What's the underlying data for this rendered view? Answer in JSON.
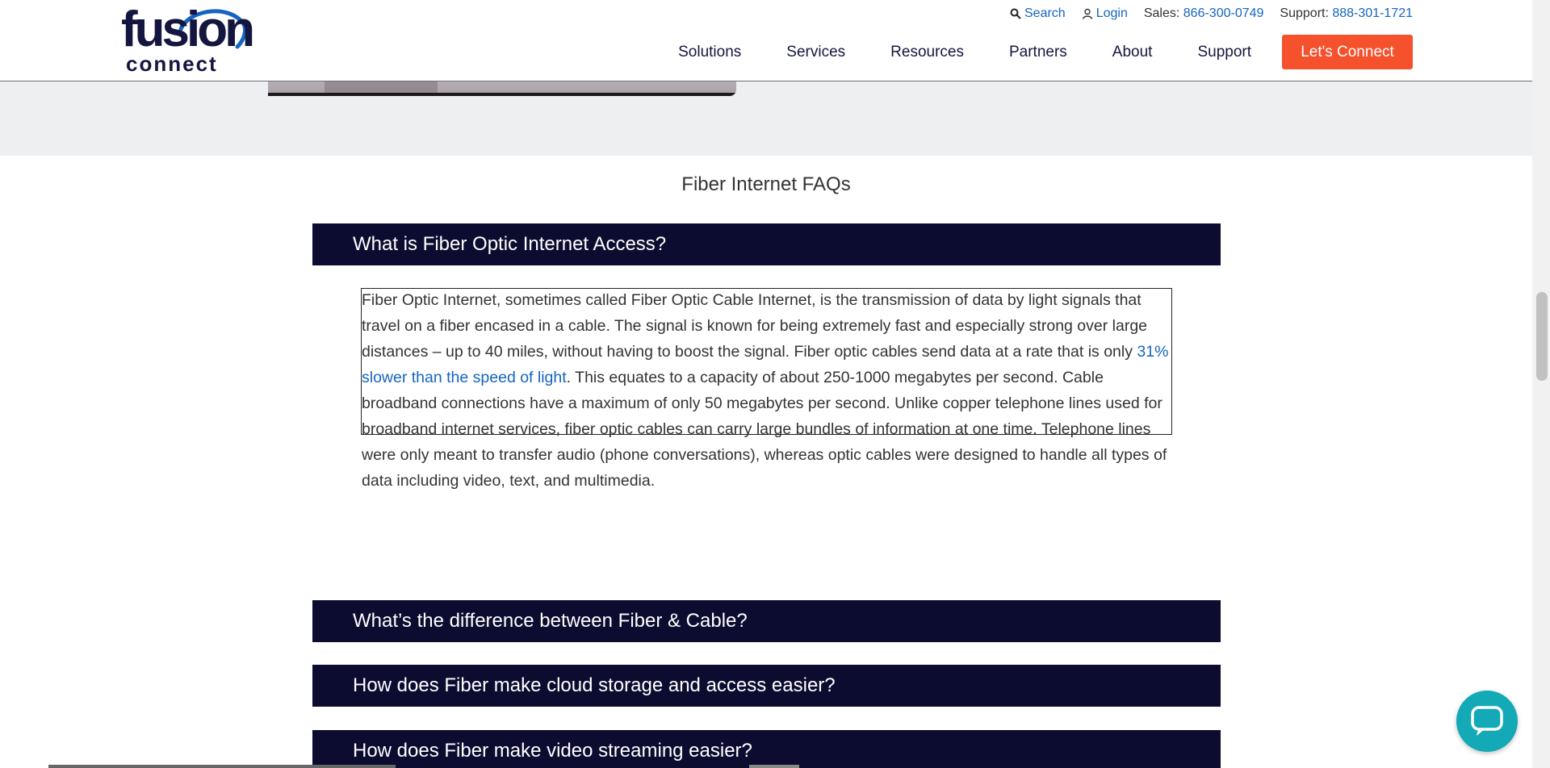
{
  "logo": {
    "word1": "fusion",
    "word2": "connect",
    "tm": "."
  },
  "utility": {
    "search_label": "Search",
    "login_label": "Login",
    "sales_label": "Sales:",
    "sales_phone": "866-300-0749",
    "support_label": "Support:",
    "support_phone": "888-301-1721"
  },
  "nav": {
    "items": [
      {
        "label": "Solutions"
      },
      {
        "label": "Services"
      },
      {
        "label": "Resources"
      },
      {
        "label": "Partners"
      },
      {
        "label": "About"
      },
      {
        "label": "Support"
      }
    ],
    "cta_label": "Let's Connect"
  },
  "faq": {
    "title": "Fiber Internet FAQs",
    "items": [
      {
        "question": "What is Fiber Optic Internet Access?"
      },
      {
        "question": "What’s the difference between Fiber & Cable?"
      },
      {
        "question": "How does Fiber make cloud storage and access easier?"
      },
      {
        "question": "How does Fiber make video streaming easier?"
      }
    ],
    "answer": {
      "part1": "Fiber Optic Internet, sometimes called Fiber Optic Cable Internet, is the transmission of data by light signals that travel on a fiber encased in a cable. The signal is known for being extremely fast and especially strong over large distances – up to 40 miles, without having to boost the signal. Fiber optic cables send data at a rate that is only ",
      "link": "31% slower than the speed of light",
      "part2": ". This equates to a capacity of about 250-1000 megabytes per second. Cable broadband connections have a maximum of only 50 megabytes per second. Unlike copper telephone lines used for broadband internet services, fiber optic cables can carry large bundles of information at one time. Telephone lines were only meant to transfer audio (phone conversations), whereas optic cables were designed to handle all types of data including video, text, and multimedia."
    }
  },
  "colors": {
    "brand_navy": "#0c0c30",
    "cta_orange": "#f4512c",
    "link_blue": "#1565c0",
    "chat_teal": "#13a9b6"
  },
  "icons": {
    "search": "search-icon",
    "login": "user-icon",
    "chat": "chat-bubble-icon"
  }
}
